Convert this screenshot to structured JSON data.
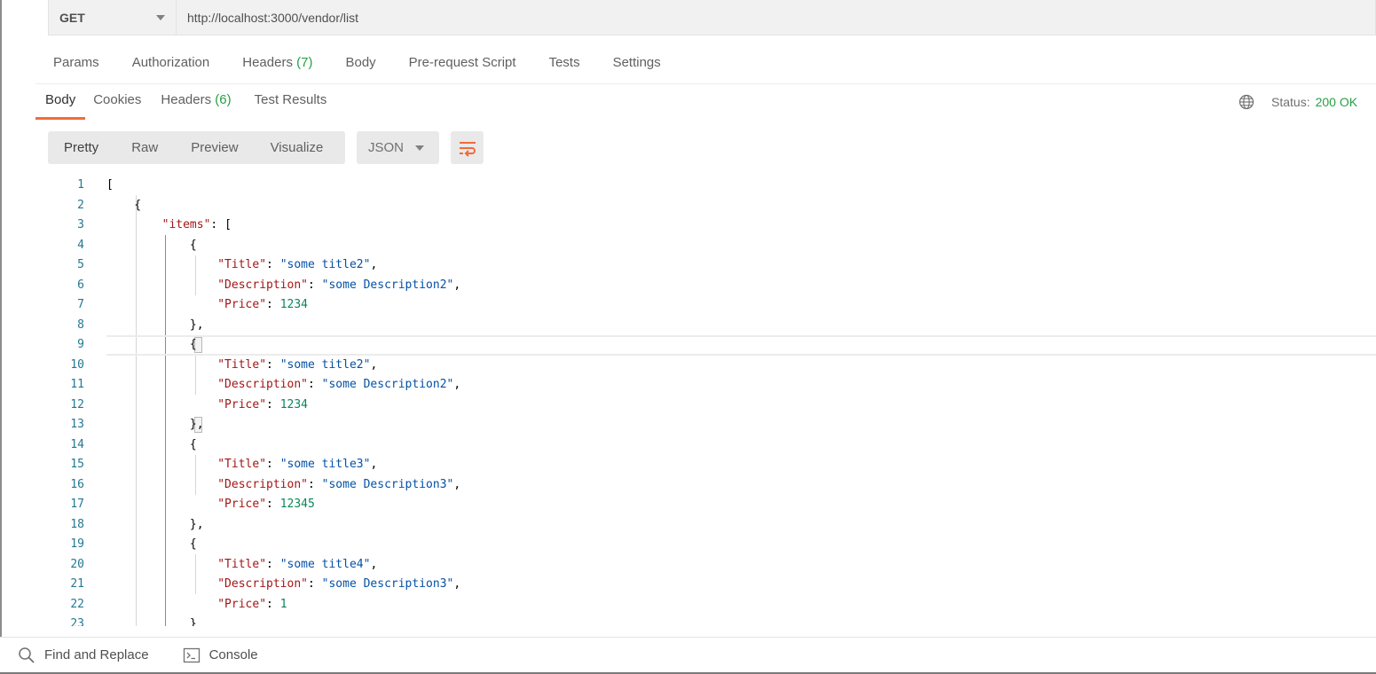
{
  "request": {
    "method": "GET",
    "url": "http://localhost:3000/vendor/list"
  },
  "request_tabs": [
    {
      "label": "Params",
      "count": ""
    },
    {
      "label": "Authorization",
      "count": ""
    },
    {
      "label": "Headers",
      "count": "(7)"
    },
    {
      "label": "Body",
      "count": ""
    },
    {
      "label": "Pre-request Script",
      "count": ""
    },
    {
      "label": "Tests",
      "count": ""
    },
    {
      "label": "Settings",
      "count": ""
    }
  ],
  "response_tabs": [
    {
      "label": "Body",
      "count": "",
      "active": true
    },
    {
      "label": "Cookies",
      "count": ""
    },
    {
      "label": "Headers",
      "count": "(6)"
    },
    {
      "label": "Test Results",
      "count": ""
    }
  ],
  "status": {
    "label": "Status:",
    "value": "200 OK"
  },
  "view_modes": [
    "Pretty",
    "Raw",
    "Preview",
    "Visualize"
  ],
  "format": {
    "selected": "JSON"
  },
  "code_lines": [
    {
      "n": "1",
      "t": [
        [
          "p",
          "["
        ]
      ]
    },
    {
      "n": "2",
      "t": [
        [
          "p",
          "    {"
        ]
      ]
    },
    {
      "n": "3",
      "t": [
        [
          "p",
          "        "
        ],
        [
          "k",
          "\"items\""
        ],
        [
          "p",
          ": ["
        ]
      ]
    },
    {
      "n": "4",
      "t": [
        [
          "p",
          "            {"
        ]
      ]
    },
    {
      "n": "5",
      "t": [
        [
          "p",
          "                "
        ],
        [
          "k",
          "\"Title\""
        ],
        [
          "p",
          ": "
        ],
        [
          "s",
          "\"some title2\""
        ],
        [
          "p",
          ","
        ]
      ]
    },
    {
      "n": "6",
      "t": [
        [
          "p",
          "                "
        ],
        [
          "k",
          "\"Description\""
        ],
        [
          "p",
          ": "
        ],
        [
          "s",
          "\"some Description2\""
        ],
        [
          "p",
          ","
        ]
      ]
    },
    {
      "n": "7",
      "t": [
        [
          "p",
          "                "
        ],
        [
          "k",
          "\"Price\""
        ],
        [
          "p",
          ": "
        ],
        [
          "n",
          "1234"
        ]
      ]
    },
    {
      "n": "8",
      "t": [
        [
          "p",
          "            },"
        ]
      ]
    },
    {
      "n": "9",
      "t": [
        [
          "p",
          "            {"
        ]
      ],
      "highlight": true
    },
    {
      "n": "10",
      "t": [
        [
          "p",
          "                "
        ],
        [
          "k",
          "\"Title\""
        ],
        [
          "p",
          ": "
        ],
        [
          "s",
          "\"some title2\""
        ],
        [
          "p",
          ","
        ]
      ]
    },
    {
      "n": "11",
      "t": [
        [
          "p",
          "                "
        ],
        [
          "k",
          "\"Description\""
        ],
        [
          "p",
          ": "
        ],
        [
          "s",
          "\"some Description2\""
        ],
        [
          "p",
          ","
        ]
      ]
    },
    {
      "n": "12",
      "t": [
        [
          "p",
          "                "
        ],
        [
          "k",
          "\"Price\""
        ],
        [
          "p",
          ": "
        ],
        [
          "n",
          "1234"
        ]
      ]
    },
    {
      "n": "13",
      "t": [
        [
          "p",
          "            },"
        ]
      ]
    },
    {
      "n": "14",
      "t": [
        [
          "p",
          "            {"
        ]
      ]
    },
    {
      "n": "15",
      "t": [
        [
          "p",
          "                "
        ],
        [
          "k",
          "\"Title\""
        ],
        [
          "p",
          ": "
        ],
        [
          "s",
          "\"some title3\""
        ],
        [
          "p",
          ","
        ]
      ]
    },
    {
      "n": "16",
      "t": [
        [
          "p",
          "                "
        ],
        [
          "k",
          "\"Description\""
        ],
        [
          "p",
          ": "
        ],
        [
          "s",
          "\"some Description3\""
        ],
        [
          "p",
          ","
        ]
      ]
    },
    {
      "n": "17",
      "t": [
        [
          "p",
          "                "
        ],
        [
          "k",
          "\"Price\""
        ],
        [
          "p",
          ": "
        ],
        [
          "n",
          "12345"
        ]
      ]
    },
    {
      "n": "18",
      "t": [
        [
          "p",
          "            },"
        ]
      ]
    },
    {
      "n": "19",
      "t": [
        [
          "p",
          "            {"
        ]
      ]
    },
    {
      "n": "20",
      "t": [
        [
          "p",
          "                "
        ],
        [
          "k",
          "\"Title\""
        ],
        [
          "p",
          ": "
        ],
        [
          "s",
          "\"some title4\""
        ],
        [
          "p",
          ","
        ]
      ]
    },
    {
      "n": "21",
      "t": [
        [
          "p",
          "                "
        ],
        [
          "k",
          "\"Description\""
        ],
        [
          "p",
          ": "
        ],
        [
          "s",
          "\"some Description3\""
        ],
        [
          "p",
          ","
        ]
      ]
    },
    {
      "n": "22",
      "t": [
        [
          "p",
          "                "
        ],
        [
          "k",
          "\"Price\""
        ],
        [
          "p",
          ": "
        ],
        [
          "n",
          "1"
        ]
      ]
    },
    {
      "n": "23",
      "t": [
        [
          "p",
          "            }"
        ]
      ]
    }
  ],
  "bottom_bar": {
    "find_replace": "Find and Replace",
    "console": "Console"
  },
  "icons": {
    "method_caret": "chevron-down-icon",
    "status": "globe-icon",
    "wrap": "wrap-lines-icon",
    "find": "search-icon",
    "console": "console-icon"
  },
  "colors": {
    "accent": "#f26b3a",
    "success": "#26a043",
    "json_key": "#a31515",
    "json_string": "#0451a5",
    "json_number": "#098658",
    "line_number": "#237893"
  }
}
